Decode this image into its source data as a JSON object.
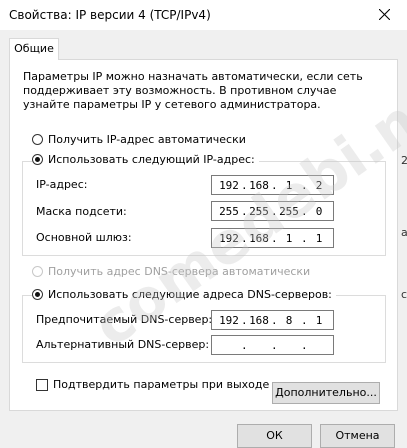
{
  "window": {
    "title": "Свойства: IP версии 4 (TCP/IPv4)",
    "close_icon": "close-icon"
  },
  "tabs": [
    {
      "label": "Общие"
    }
  ],
  "description": "Параметры IP можно назначать автоматически, если сеть поддерживает эту возможность. В противном случае узнайте параметры IP у сетевого администратора.",
  "ip_settings": {
    "auto_label": "Получить IP-адрес автоматически",
    "static_label": "Использовать следующий IP-адрес:",
    "mode": "static",
    "fields": [
      {
        "label": "IP-адрес:",
        "value": [
          "192",
          "168",
          "1",
          "2"
        ]
      },
      {
        "label": "Маска подсети:",
        "value": [
          "255",
          "255",
          "255",
          "0"
        ]
      },
      {
        "label": "Основной шлюз:",
        "value": [
          "192",
          "168",
          "1",
          "1"
        ]
      }
    ]
  },
  "dns_settings": {
    "auto_label": "Получить адрес DNS-сервера автоматически",
    "static_label": "Использовать следующие адреса DNS-серверов:",
    "mode": "static",
    "fields": [
      {
        "label": "Предпочитаемый DNS-сервер:",
        "value": [
          "192",
          "168",
          "8",
          "1"
        ]
      },
      {
        "label": "Альтернативный DNS-сервер:",
        "value": [
          "",
          "",
          "",
          ""
        ]
      }
    ]
  },
  "validate_on_exit": {
    "label": "Подтвердить параметры при выходе",
    "checked": false
  },
  "buttons": {
    "advanced": "Дополнительно...",
    "ok": "ОК",
    "cancel": "Отмена"
  },
  "watermark": "comedebi.net",
  "edge_glyphs": [
    "2",
    "a",
    "c"
  ]
}
